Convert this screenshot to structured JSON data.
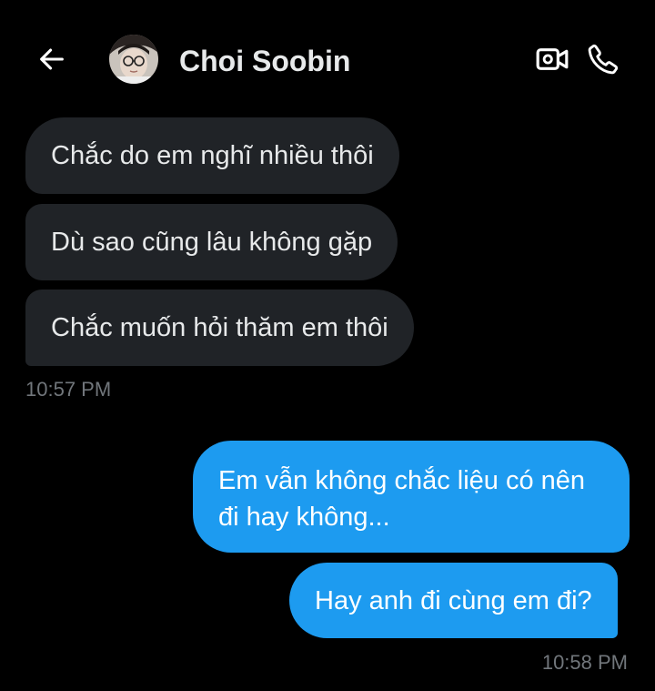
{
  "header": {
    "contact_name": "Choi Soobin",
    "back_icon": "arrow-left-icon",
    "video_icon": "video-camera-icon",
    "call_icon": "phone-icon"
  },
  "theme": {
    "background": "#000000",
    "incoming_bubble": "#202327",
    "outgoing_bubble": "#1d9bf0",
    "timestamp": "#71767b"
  },
  "messages": {
    "incoming": [
      {
        "text": "Chắc do em nghĩ nhiều thôi"
      },
      {
        "text": "Dù sao cũng lâu không gặp"
      },
      {
        "text": "Chắc muốn hỏi thăm em thôi"
      }
    ],
    "incoming_time": "10:57 PM",
    "outgoing": [
      {
        "text": "Em vẫn không chắc liệu có nên đi hay không..."
      },
      {
        "text": "Hay anh đi cùng em đi?"
      }
    ],
    "outgoing_time": "10:58 PM"
  }
}
